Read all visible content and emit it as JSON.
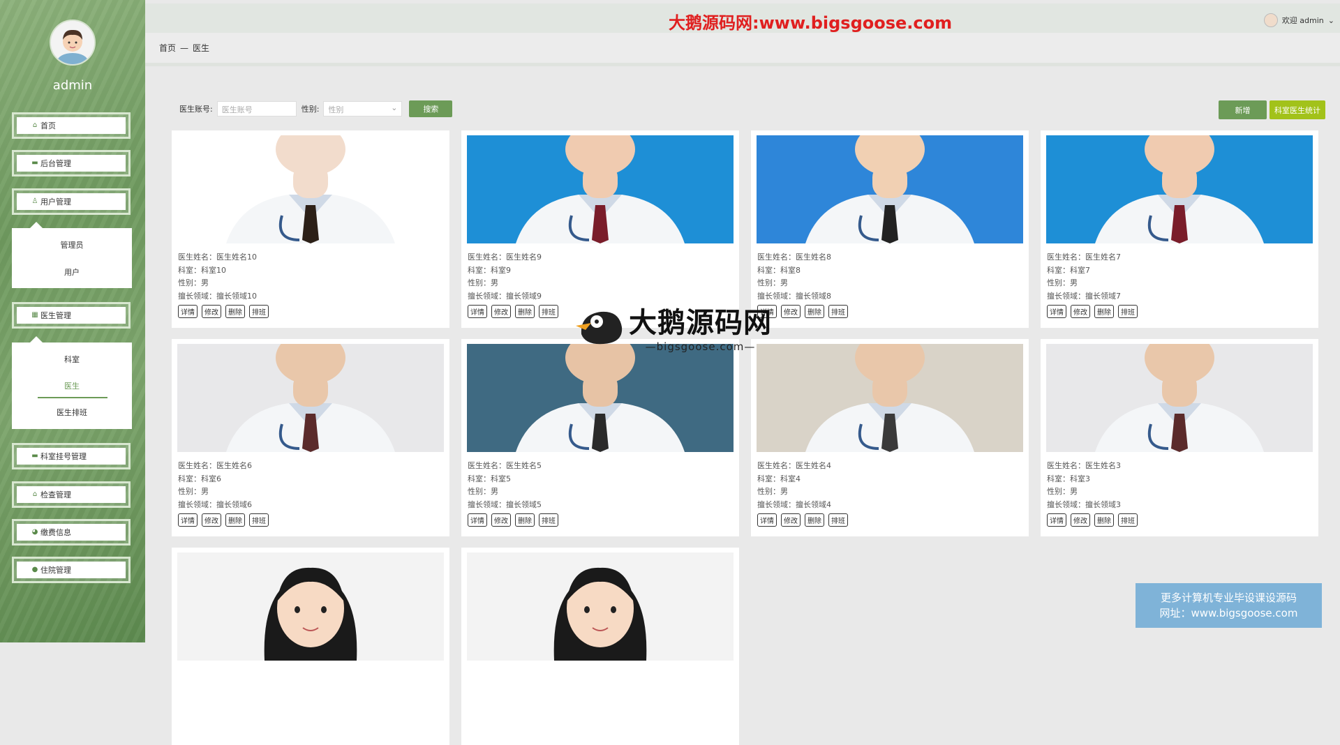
{
  "top_watermark": "大鹅源码网:www.bigsgoose.com",
  "header": {
    "welcome": "欢迎 admin"
  },
  "breadcrumb": {
    "home": "首页",
    "separator": "—",
    "current": "医生"
  },
  "sidebar": {
    "username": "admin",
    "menu": [
      {
        "label": "首页",
        "icon": "home-icon"
      },
      {
        "label": "后台管理",
        "icon": "monitor-icon"
      },
      {
        "label": "用户管理",
        "icon": "user-icon"
      },
      {
        "label": "医生管理",
        "icon": "grid-icon"
      },
      {
        "label": "科室挂号管理",
        "icon": "monitor-icon"
      },
      {
        "label": "检查管理",
        "icon": "building-icon"
      },
      {
        "label": "缴费信息",
        "icon": "pie-icon"
      },
      {
        "label": "住院管理",
        "icon": "leaf-icon"
      }
    ],
    "user_submenu": [
      "管理员",
      "用户"
    ],
    "doctor_submenu": [
      "科室",
      "医生",
      "医生排班"
    ]
  },
  "search": {
    "account_label": "医生账号:",
    "account_placeholder": "医生账号",
    "gender_label": "性别:",
    "gender_placeholder": "性别",
    "search_button": "搜索"
  },
  "toolbar": {
    "add": "新增",
    "stats": "科室医生统计"
  },
  "card_labels": {
    "name": "医生姓名：",
    "dept": "科室：",
    "gender": "性别：",
    "specialty": "擅长领域："
  },
  "card_actions": [
    "详情",
    "修改",
    "删除",
    "排班"
  ],
  "doctors": [
    {
      "name": "医生姓名10",
      "dept": "科室10",
      "gender": "男",
      "specialty": "擅长领域10"
    },
    {
      "name": "医生姓名9",
      "dept": "科室9",
      "gender": "男",
      "specialty": "擅长领域9"
    },
    {
      "name": "医生姓名8",
      "dept": "科室8",
      "gender": "男",
      "specialty": "擅长领域8"
    },
    {
      "name": "医生姓名7",
      "dept": "科室7",
      "gender": "男",
      "specialty": "擅长领域7"
    },
    {
      "name": "医生姓名6",
      "dept": "科室6",
      "gender": "男",
      "specialty": "擅长领域6"
    },
    {
      "name": "医生姓名5",
      "dept": "科室5",
      "gender": "男",
      "specialty": "擅长领域5"
    },
    {
      "name": "医生姓名4",
      "dept": "科室4",
      "gender": "男",
      "specialty": "擅长领域4"
    },
    {
      "name": "医生姓名3",
      "dept": "科室3",
      "gender": "男",
      "specialty": "擅长领域3"
    },
    {
      "name": "",
      "dept": "",
      "gender": "",
      "specialty": ""
    },
    {
      "name": "",
      "dept": "",
      "gender": "",
      "specialty": ""
    }
  ],
  "center_watermark": {
    "title": "大鹅源码网",
    "url": "—bigsgoose.com—"
  },
  "ad": {
    "line1": "更多计算机专业毕设课设源码",
    "line2": "网址：www.bigsgoose.com"
  },
  "colors": {
    "accent": "#6c9b57",
    "stats_button": "#a2c21a",
    "watermark_red": "#e01f1f",
    "ad_bg": "#7fb3d8"
  }
}
